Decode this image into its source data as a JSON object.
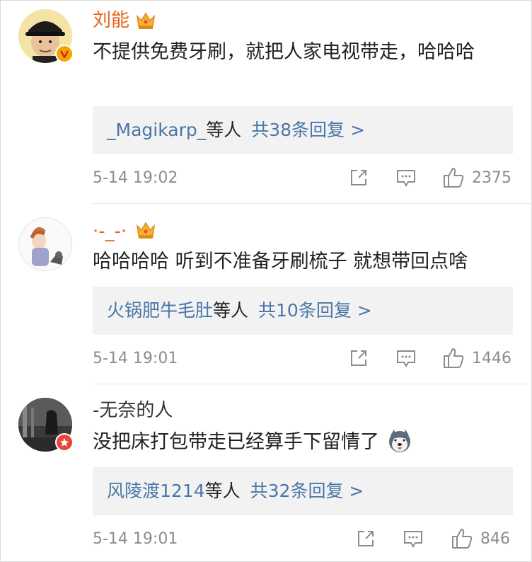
{
  "comments": [
    {
      "username": "刘能",
      "text": "不提供免费牙刷，就把人家电视带走，哈哈哈",
      "reply_users": "_Magikarp_",
      "reply_suffix": "等人",
      "reply_count": "共38条回复 >",
      "time": "5-14 19:02",
      "likes": "2375",
      "name_color": "#e8631a",
      "verified": true
    },
    {
      "username": "·-_-·",
      "text": "哈哈哈哈 听到不准备牙刷梳子 就想带回点啥",
      "reply_users": "火锅肥牛毛肚",
      "reply_suffix": "等人",
      "reply_count": "共10条回复 >",
      "time": "5-14 19:01",
      "likes": "1446",
      "name_color": "#e8631a",
      "verified": false
    },
    {
      "username": "-无奈的人",
      "text": "没把床打包带走已经算手下留情了",
      "reply_users": "风陵渡1214",
      "reply_suffix": "等人",
      "reply_count": "共32条回复 >",
      "time": "5-14 19:01",
      "likes": "846",
      "name_color": "#333333",
      "verified": false
    }
  ],
  "icons": {
    "share": "share-icon",
    "comment": "comment-icon",
    "like": "thumbs-up-icon",
    "crown": "vip-crown-icon",
    "emoji": "husky-emoji-icon"
  }
}
